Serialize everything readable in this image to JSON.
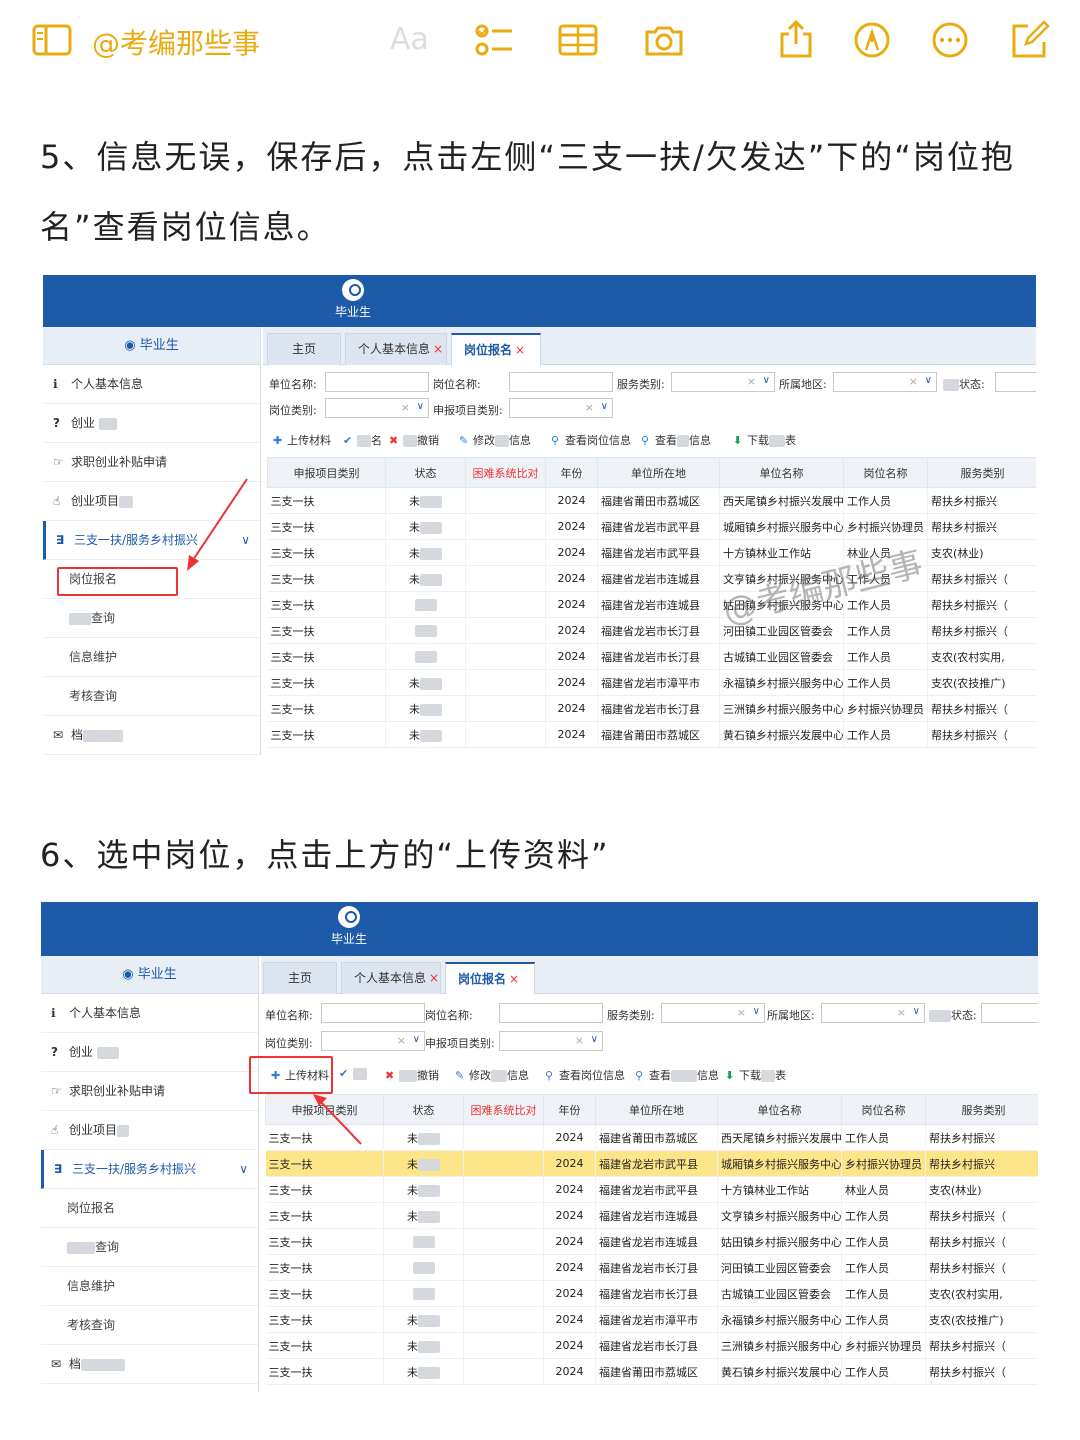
{
  "toolbar": {
    "title": "@考编那些事",
    "aa_label": "Aa",
    "icons": [
      "sidebar-icon",
      "checklist-icon",
      "table-icon",
      "camera-icon",
      "share-icon",
      "markup-icon",
      "more-icon",
      "compose-icon"
    ],
    "accent": "#e8ac12"
  },
  "steps": {
    "step5": "5、信息无误，保存后，点击左侧“三支一扶/欠发达”下的“岗位抱名”查看岗位信息。",
    "step6": "6、选中岗位，点击上方的“上传资料”"
  },
  "watermark": "@考编那些事",
  "app": {
    "header_user": "毕业生",
    "brand_color": "#1d5aa8",
    "sidebar_header": "毕业生",
    "sidebar": [
      {
        "label": "个人基本信息",
        "icon": "info-icon"
      },
      {
        "label": "创业",
        "icon": "question-icon"
      },
      {
        "label": "求职创业补贴申请",
        "icon": "handshake-icon"
      },
      {
        "label": "创业项目",
        "icon": "hand-icon"
      },
      {
        "label": "三支一扶/服务乡村振兴",
        "icon": "css3-icon",
        "active": true
      },
      {
        "label": "岗位报名"
      },
      {
        "label": "查询"
      },
      {
        "label": "信息维护"
      },
      {
        "label": "考核查询"
      },
      {
        "label": "档",
        "icon": "envelope-icon"
      }
    ],
    "tabs": [
      {
        "label": "主页"
      },
      {
        "label": "个人基本信息",
        "close": "×"
      },
      {
        "label": "岗位报名",
        "close": "×"
      }
    ],
    "filters": {
      "unit_name": "单位名称:",
      "post_name": "岗位名称:",
      "service_type": "服务类别:",
      "region": "所属地区:",
      "status": "状态:",
      "post_type": "岗位类别:",
      "project_type": "申报项目类别:",
      "clear": "×",
      "dropdown": "∨"
    },
    "actions": {
      "upload": "上传材料",
      "signup": "名",
      "cancel": "撤销",
      "modify": "修改",
      "modify_tail": "信息",
      "view_post": "查看岗位信息",
      "view": "查看",
      "view_tail": "信息",
      "download": "下载",
      "download_tail": "表"
    },
    "columns": [
      "申报项目类别",
      "状态",
      "困难系统比对",
      "年份",
      "单位所在地",
      "单位名称",
      "岗位名称",
      "服务类别"
    ],
    "rows": [
      [
        "三支一扶",
        "未",
        "",
        "2024",
        "福建省莆田市荔城区",
        "西天尾镇乡村振兴发展中",
        "工作人员",
        "帮扶乡村振兴"
      ],
      [
        "三支一扶",
        "未",
        "",
        "2024",
        "福建省龙岩市武平县",
        "城厢镇乡村振兴服务中心",
        "乡村振兴协理员",
        "帮扶乡村振兴"
      ],
      [
        "三支一扶",
        "未",
        "",
        "2024",
        "福建省龙岩市武平县",
        "十方镇林业工作站",
        "林业人员",
        "支农(林业)"
      ],
      [
        "三支一扶",
        "未",
        "",
        "2024",
        "福建省龙岩市连城县",
        "文亨镇乡村振兴服务中心",
        "工作人员",
        "帮扶乡村振兴（"
      ],
      [
        "三支一扶",
        "",
        "",
        "2024",
        "福建省龙岩市连城县",
        "姑田镇乡村振兴服务中心",
        "工作人员",
        "帮扶乡村振兴（"
      ],
      [
        "三支一扶",
        "",
        "",
        "2024",
        "福建省龙岩市长汀县",
        "河田镇工业园区管委会",
        "工作人员",
        "帮扶乡村振兴（"
      ],
      [
        "三支一扶",
        "",
        "",
        "2024",
        "福建省龙岩市长汀县",
        "古城镇工业园区管委会",
        "工作人员",
        "支农(农村实用,"
      ],
      [
        "三支一扶",
        "未",
        "",
        "2024",
        "福建省龙岩市漳平市",
        "永福镇乡村振兴服务中心",
        "工作人员",
        "支农(农技推广)"
      ],
      [
        "三支一扶",
        "未",
        "",
        "2024",
        "福建省龙岩市长汀县",
        "三洲镇乡村振兴服务中心",
        "乡村振兴协理员",
        "帮扶乡村振兴（"
      ],
      [
        "三支一扶",
        "未",
        "",
        "2024",
        "福建省莆田市荔城区",
        "黄石镇乡村振兴发展中心",
        "工作人员",
        "帮扶乡村振兴（"
      ]
    ],
    "highlight_color": "#fde58a",
    "annotation_color": "#e33333"
  }
}
